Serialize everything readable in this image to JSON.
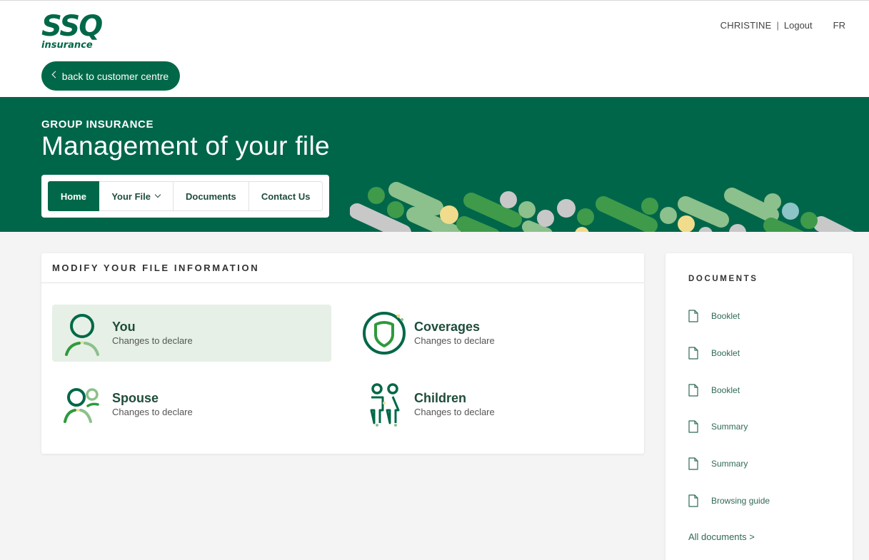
{
  "logo": {
    "main": "SSQ",
    "sub": "insurance"
  },
  "user": {
    "name": "CHRISTINE",
    "separator": "|",
    "logout_label": "Logout",
    "language": "FR"
  },
  "back_button": {
    "label": "back to customer centre"
  },
  "hero": {
    "eyebrow": "GROUP INSURANCE",
    "title": "Management of your file"
  },
  "nav": {
    "home": "Home",
    "your_file": "Your File",
    "documents": "Documents",
    "contact": "Contact Us",
    "active": "Home"
  },
  "modify_card": {
    "title": "MODIFY YOUR FILE INFORMATION",
    "tiles": [
      {
        "title": "You",
        "subtitle": "Changes to declare",
        "icon": "person-icon",
        "selected": true
      },
      {
        "title": "Coverages",
        "subtitle": "Changes to declare",
        "icon": "shield-icon",
        "selected": false
      },
      {
        "title": "Spouse",
        "subtitle": "Changes to declare",
        "icon": "couple-icon",
        "selected": false
      },
      {
        "title": "Children",
        "subtitle": "Changes to declare",
        "icon": "children-icon",
        "selected": false
      }
    ]
  },
  "documents": {
    "title": "DOCUMENTS",
    "items": [
      {
        "label": "Booklet",
        "icon": "document-icon"
      },
      {
        "label": "Booklet",
        "icon": "document-icon"
      },
      {
        "label": "Booklet",
        "icon": "document-icon"
      },
      {
        "label": "Summary",
        "icon": "document-icon"
      },
      {
        "label": "Summary",
        "icon": "document-icon"
      },
      {
        "label": "Browsing guide",
        "icon": "document-icon"
      }
    ],
    "all_link": "All documents >"
  },
  "colors": {
    "brand_green": "#006848",
    "hero_green": "#00664a",
    "tile_selected_bg": "#e6f0e6",
    "accent_light_green": "#8cc08c",
    "accent_yellow": "#f0dc8c",
    "accent_grey": "#c8c8c8",
    "accent_teal": "#8cc4c8"
  }
}
